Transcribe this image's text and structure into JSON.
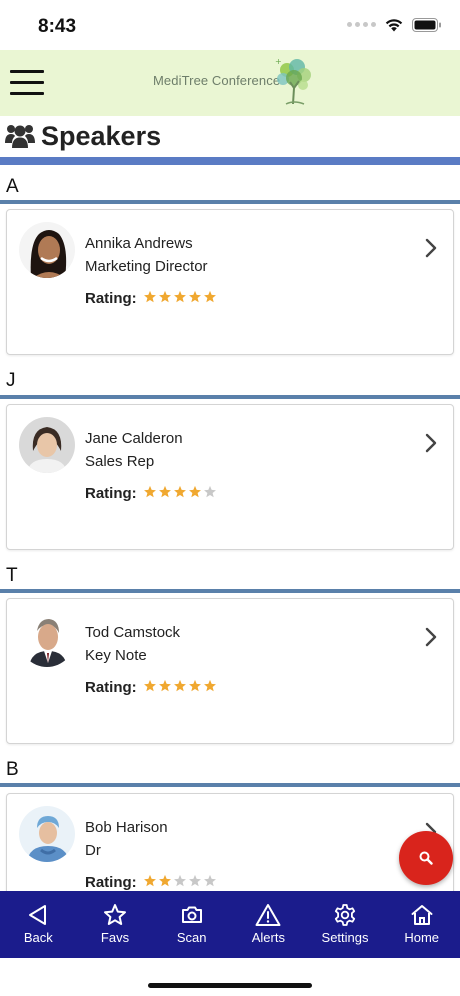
{
  "status": {
    "time": "8:43"
  },
  "header": {
    "brand": "MediTree Conference"
  },
  "page": {
    "title": "Speakers"
  },
  "sections": [
    {
      "letter": "A",
      "speaker": {
        "name": "Annika Andrews",
        "title": "Marketing Director",
        "rating_label": "Rating:",
        "rating": 5
      }
    },
    {
      "letter": "J",
      "speaker": {
        "name": "Jane Calderon",
        "title": "Sales Rep",
        "rating_label": "Rating:",
        "rating": 4
      }
    },
    {
      "letter": "T",
      "speaker": {
        "name": "Tod Camstock",
        "title": "Key Note",
        "rating_label": "Rating:",
        "rating": 5
      }
    },
    {
      "letter": "B",
      "speaker": {
        "name": "Bob Harison",
        "title": "Dr",
        "rating_label": "Rating:",
        "rating": 2
      }
    }
  ],
  "rating_max": 5,
  "nav": [
    {
      "label": "Back",
      "icon": "back-triangle-icon"
    },
    {
      "label": "Favs",
      "icon": "star-outline-icon"
    },
    {
      "label": "Scan",
      "icon": "camera-icon"
    },
    {
      "label": "Alerts",
      "icon": "warning-icon"
    },
    {
      "label": "Settings",
      "icon": "gear-icon"
    },
    {
      "label": "Home",
      "icon": "home-icon"
    }
  ],
  "colors": {
    "header_bg": "#eaf6d3",
    "title_bar": "#5a7bc4",
    "section_line": "#5a80aa",
    "nav_bg": "#1b1c8c",
    "fab": "#d9241c",
    "star_filled": "#f0a830",
    "star_empty": "#c8c8c8"
  }
}
